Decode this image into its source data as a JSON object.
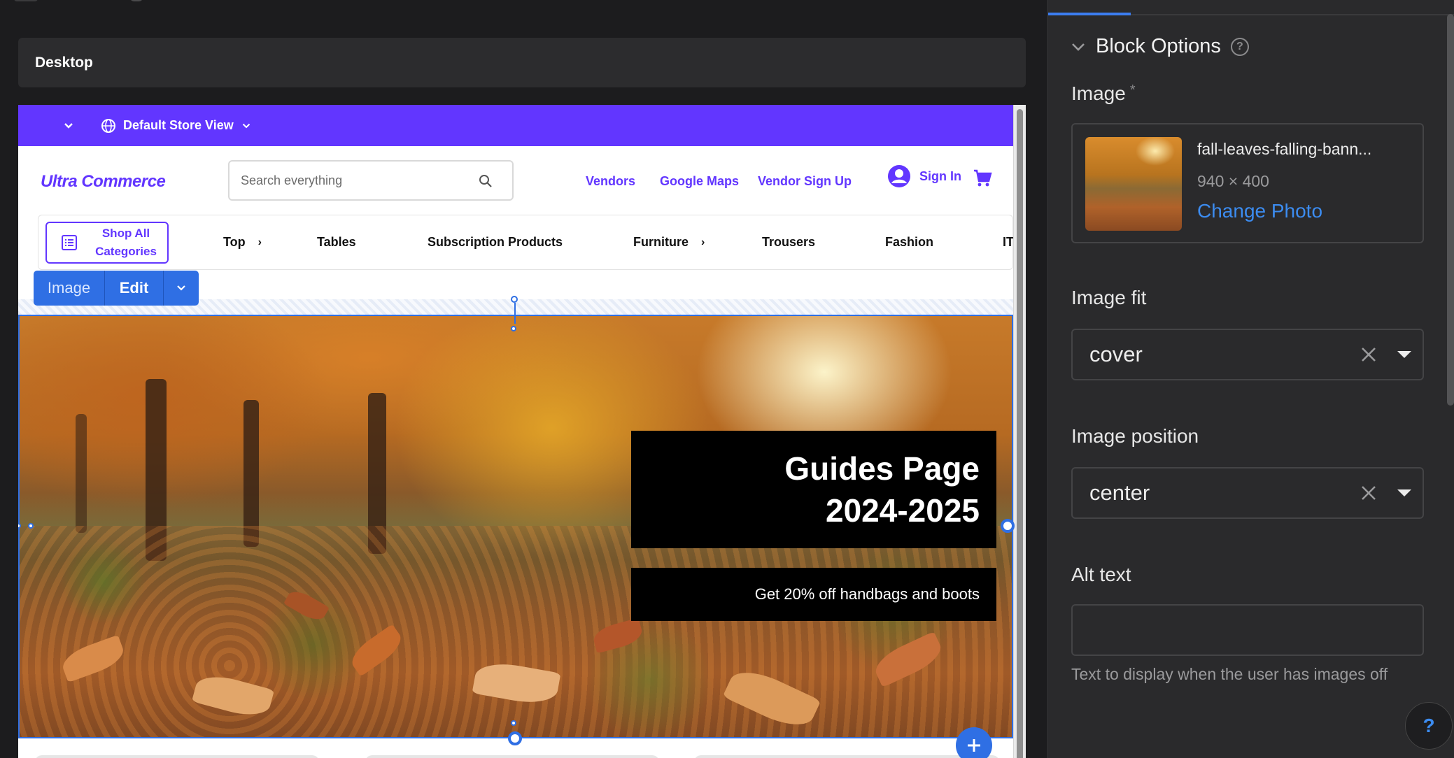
{
  "device": {
    "label": "Desktop"
  },
  "store_bar": {
    "store_label": "Default Store View"
  },
  "header": {
    "logo": "Ultra Commerce",
    "search_placeholder": "Search everything",
    "nav": [
      "Vendors",
      "Google Maps",
      "Vendor Sign Up"
    ],
    "sign_in": "Sign In"
  },
  "categories": {
    "shop_all": "Shop All Categories",
    "items": [
      {
        "label": "Top",
        "has_arrow": true
      },
      {
        "label": "Tables",
        "has_arrow": false
      },
      {
        "label": "Subscription Products",
        "has_arrow": false
      },
      {
        "label": "Furniture",
        "has_arrow": true
      },
      {
        "label": "Trousers",
        "has_arrow": false
      },
      {
        "label": "Fashion",
        "has_arrow": false
      },
      {
        "label": "IT",
        "has_arrow": true
      }
    ]
  },
  "block_toolbar": {
    "type_label": "Image",
    "edit_label": "Edit"
  },
  "hero": {
    "headline_line1": "Guides Page",
    "headline_line2": "2024-2025",
    "promo": "Get 20% off handbags and boots"
  },
  "panel": {
    "section_title": "Block Options",
    "image_label": "Image",
    "required_mark": "*",
    "image_file": "fall-leaves-falling-bann...",
    "image_dims": "940 × 400",
    "change_photo": "Change Photo",
    "image_fit_label": "Image fit",
    "image_fit_value": "cover",
    "image_position_label": "Image position",
    "image_position_value": "center",
    "alt_text_label": "Alt text",
    "alt_text_value": "",
    "alt_text_hint": "Text to display when the user has images off",
    "help_glyph": "?"
  },
  "colors": {
    "brand_purple": "#6236ff",
    "editor_blue": "#2f6fe4",
    "link_blue": "#3c8cf0",
    "panel_bg": "#2a2a2c"
  }
}
